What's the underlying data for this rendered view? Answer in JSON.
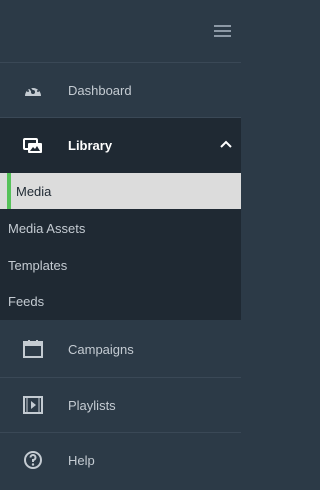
{
  "nav": {
    "dashboard": {
      "label": "Dashboard",
      "icon": "gauge-icon"
    },
    "library": {
      "label": "Library",
      "icon": "images-icon",
      "expanded": true
    },
    "campaigns": {
      "label": "Campaigns",
      "icon": "calendar-icon"
    },
    "playlists": {
      "label": "Playlists",
      "icon": "play-box-icon"
    },
    "help": {
      "label": "Help",
      "icon": "question-circle-icon"
    }
  },
  "library_submenu": [
    {
      "label": "Media",
      "active": true
    },
    {
      "label": "Media Assets",
      "active": false
    },
    {
      "label": "Templates",
      "active": false
    },
    {
      "label": "Feeds",
      "active": false
    }
  ],
  "colors": {
    "sidebar_bg": "#2c3a47",
    "submenu_bg": "#1f2933",
    "active_bg": "#dcdcdc",
    "active_marker": "#56c25a",
    "text": "#c4cbd2"
  }
}
